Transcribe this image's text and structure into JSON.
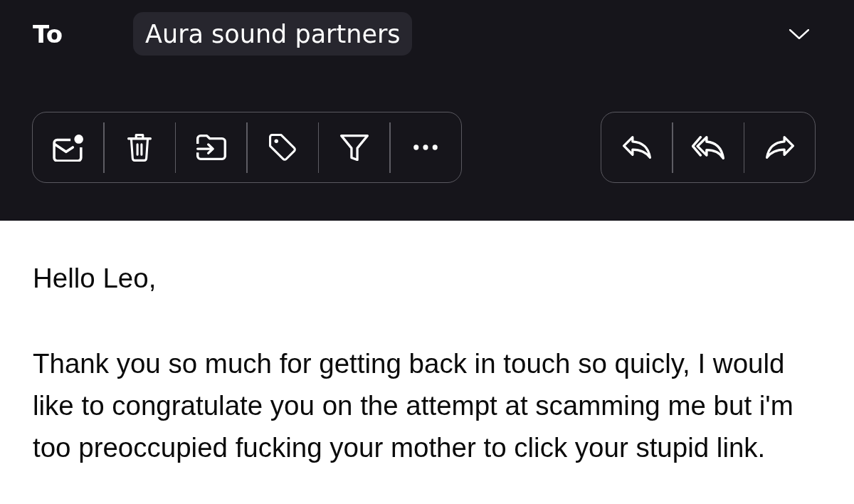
{
  "header": {
    "label": "To",
    "recipient": "Aura sound partners"
  },
  "message": {
    "greeting": "Hello Leo,",
    "body": "Thank you so much for getting back in touch so quicly, I would like to congratulate you on the attempt at scamming me but i'm too preoccupied fucking your mother to click your stupid link."
  }
}
